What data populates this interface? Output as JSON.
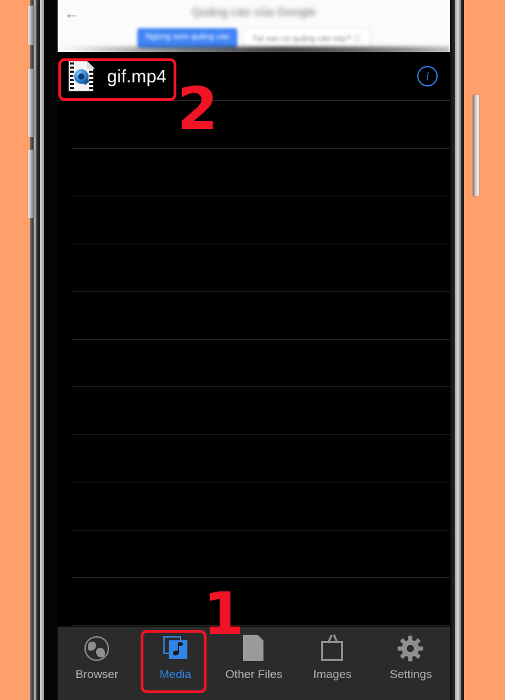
{
  "device": {
    "background_color": "#FFA06A",
    "frame_color": "#0b0b0b",
    "buttons": [
      "mute-switch",
      "volume-up",
      "volume-down",
      "power"
    ]
  },
  "ad_banner": {
    "back_icon": "back-arrow-icon",
    "title": "Quảng cáo của Google",
    "primary_button": "Ngừng xem quảng cáo",
    "secondary_button": "Tại sao có quảng cáo này? ⓘ",
    "blurred": true,
    "background_color": "#fbfbfb"
  },
  "file_list": {
    "background_color": "#000000",
    "separator_color": "#242424",
    "files": [
      {
        "name": "gif.mp4",
        "icon": "quicktime-video-file-icon",
        "info_icon": "info-circle-icon"
      }
    ],
    "empty_row_count": 11
  },
  "tab_bar": {
    "background_color": "#2b2b2b",
    "active_color": "#2f86e8",
    "inactive_color": "#b6b6b6",
    "tabs": [
      {
        "label": "Browser",
        "icon": "globe-icon",
        "active": false
      },
      {
        "label": "Media",
        "icon": "media-note-icon",
        "active": true
      },
      {
        "label": "Other Files",
        "icon": "document-icon",
        "active": false
      },
      {
        "label": "Images",
        "icon": "picture-frame-icon",
        "active": false
      },
      {
        "label": "Settings",
        "icon": "gear-icon",
        "active": false
      }
    ]
  },
  "annotations": {
    "color": "#f01425",
    "markers": [
      {
        "label": "1",
        "target": "Media tab"
      },
      {
        "label": "2",
        "target": "gif.mp4 file row"
      }
    ]
  }
}
